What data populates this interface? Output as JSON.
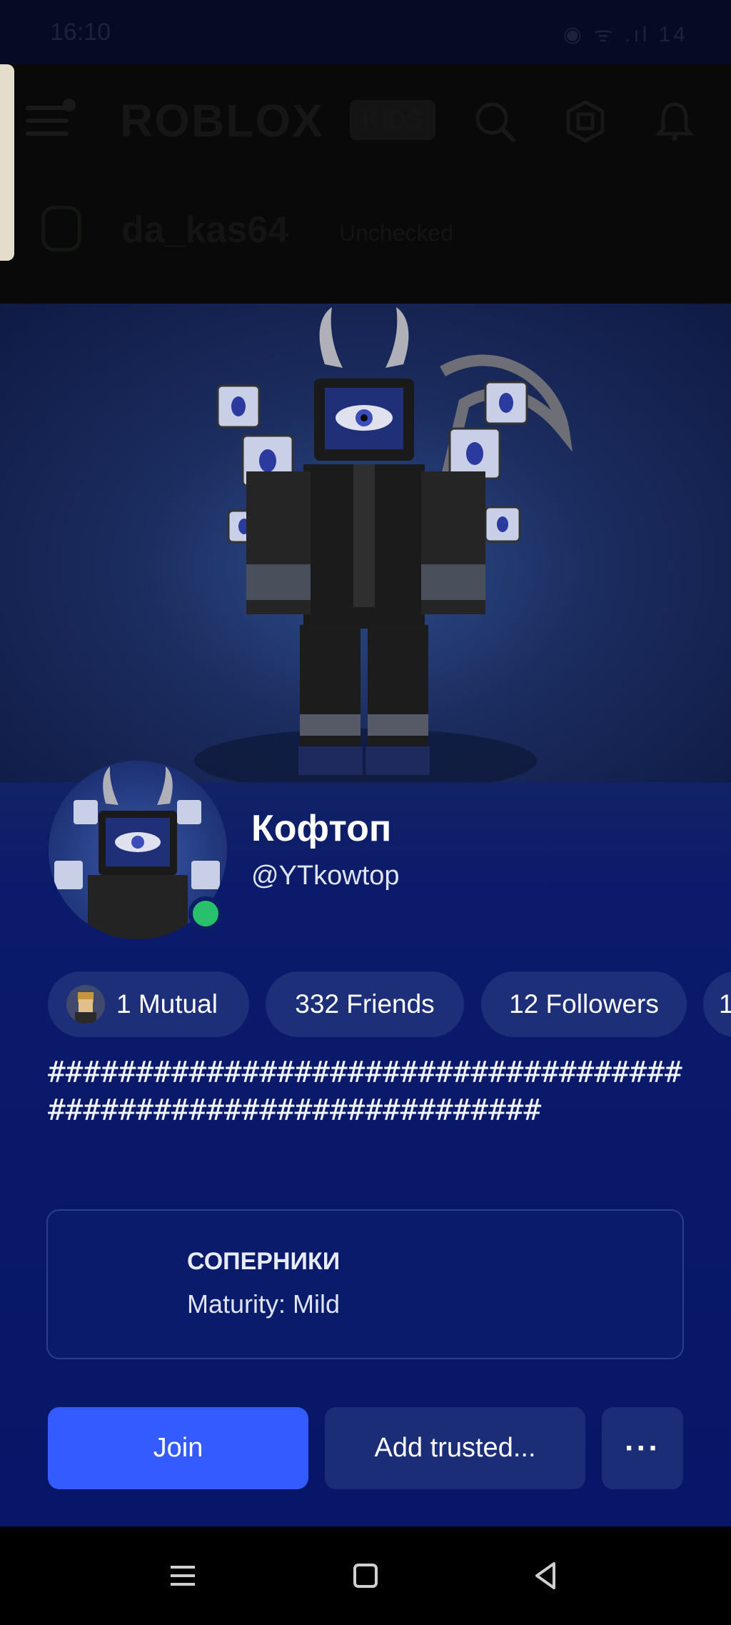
{
  "status_bar": {
    "time": "16:10",
    "indicators": "◉ ᯤ .ıl 14"
  },
  "header": {
    "brand": "ROBLOX",
    "brand_badge": "KIDS",
    "account_name": "da_kas64",
    "account_status": "Unchecked"
  },
  "profile": {
    "display_name": "Кофтоп",
    "username": "@YTkowtop",
    "online": true,
    "chips": {
      "mutual": "1 Mutual",
      "friends": "332 Friends",
      "followers": "12 Followers",
      "more": "1"
    },
    "bio": "################################################################",
    "experience": {
      "title": "СОПЕРНИКИ",
      "maturity": "Maturity: Mild"
    },
    "actions": {
      "join": "Join",
      "add_trusted": "Add trusted...",
      "more": "···"
    }
  },
  "colors": {
    "join_button": "#335bff",
    "secondary_button": "#1c2d78",
    "online": "#28c06c"
  }
}
